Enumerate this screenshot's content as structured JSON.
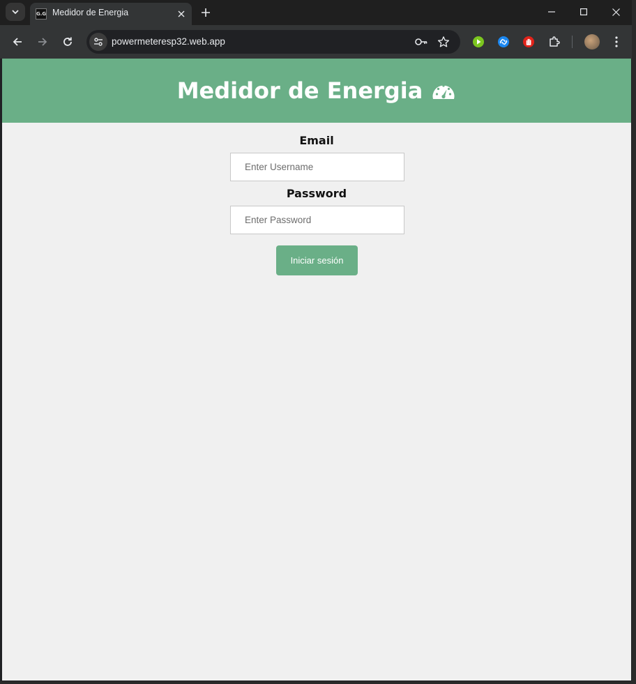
{
  "browser": {
    "tab": {
      "title": "Medidor de Energia",
      "favicon_text": "G.G"
    },
    "url": "powermeteresp32.web.app",
    "icons": {
      "tab_search": "chevron-down-icon",
      "close_tab": "close-icon",
      "new_tab": "plus-icon",
      "back": "arrow-left-icon",
      "forward": "arrow-right-icon",
      "reload": "reload-icon",
      "site_info": "tune-icon",
      "password": "key-icon",
      "bookmark": "star-icon",
      "extensions": [
        "play-extension-icon",
        "shazam-extension-icon",
        "stop-hand-extension-icon",
        "puzzle-icon"
      ],
      "menu": "kebab-menu-icon"
    },
    "colors": {
      "frame": "#1f1f1f",
      "toolbar": "#333536",
      "omnibox": "#202124"
    }
  },
  "page": {
    "header": {
      "title": "Medidor de Energia",
      "icon": "gauge-icon"
    },
    "email": {
      "label": "Email",
      "placeholder": "Enter Username"
    },
    "password": {
      "label": "Password",
      "placeholder": "Enter Password"
    },
    "login_button": "Iniciar sesión",
    "colors": {
      "accent": "#6aaf87",
      "background": "#f0f0f0"
    }
  }
}
